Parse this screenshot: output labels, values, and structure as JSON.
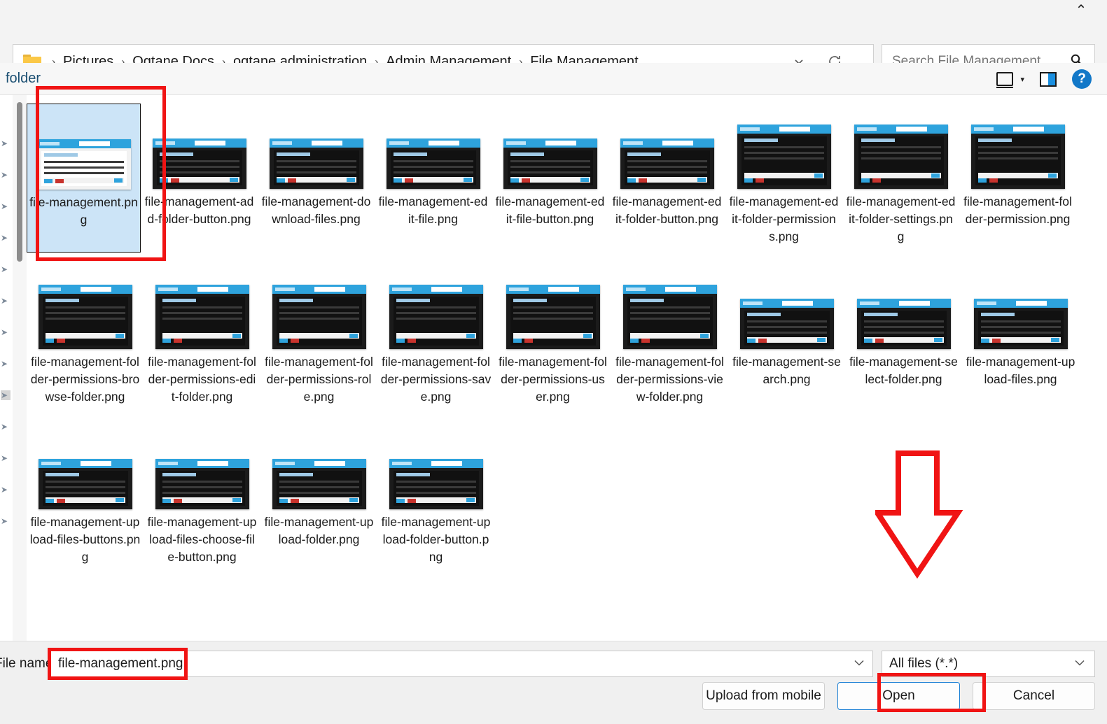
{
  "window": {
    "close_label": "⌃"
  },
  "address": {
    "folder_icon": "folder-icon",
    "breadcrumbs": [
      "Pictures",
      "Oqtane Docs",
      "oqtane administration",
      "Admin Management",
      "File Management"
    ],
    "separator": "›",
    "dropdown_icon": "chevron-down-icon",
    "refresh_icon": "refresh-icon"
  },
  "search": {
    "placeholder": "Search File Management",
    "icon": "search-icon"
  },
  "commandbar": {
    "folder_label": "folder",
    "view_icon": "view-layout-icon",
    "view_caret": "▾",
    "preview_pane_icon": "preview-pane-icon",
    "help_icon": "help-icon",
    "help_label": "?"
  },
  "files": [
    {
      "name": "file-management.png",
      "selected": true,
      "style": "light"
    },
    {
      "name": "file-management-add-folder-button.png",
      "selected": false,
      "style": "dark"
    },
    {
      "name": "file-management-download-files.png",
      "selected": false,
      "style": "dark"
    },
    {
      "name": "file-management-edit-file.png",
      "selected": false,
      "style": "dark"
    },
    {
      "name": "file-management-edit-file-button.png",
      "selected": false,
      "style": "dark"
    },
    {
      "name": "file-management-edit-folder-button.png",
      "selected": false,
      "style": "dark"
    },
    {
      "name": "file-management-edit-folder-permissions.png",
      "selected": false,
      "style": "tall"
    },
    {
      "name": "file-management-edit-folder-settings.png",
      "selected": false,
      "style": "tall"
    },
    {
      "name": "file-management-folder-permission.png",
      "selected": false,
      "style": "tall"
    },
    {
      "name": "file-management-folder-permissions-browse-folder.png",
      "selected": false,
      "style": "tall"
    },
    {
      "name": "file-management-folder-permissions-edit-folder.png",
      "selected": false,
      "style": "tall"
    },
    {
      "name": "file-management-folder-permissions-role.png",
      "selected": false,
      "style": "tall"
    },
    {
      "name": "file-management-folder-permissions-save.png",
      "selected": false,
      "style": "tall"
    },
    {
      "name": "file-management-folder-permissions-user.png",
      "selected": false,
      "style": "tall"
    },
    {
      "name": "file-management-folder-permissions-view-folder.png",
      "selected": false,
      "style": "tall"
    },
    {
      "name": "file-management-search.png",
      "selected": false,
      "style": "dark"
    },
    {
      "name": "file-management-select-folder.png",
      "selected": false,
      "style": "dark"
    },
    {
      "name": "file-management-upload-files.png",
      "selected": false,
      "style": "dark"
    },
    {
      "name": "file-management-upload-files-buttons.png",
      "selected": false,
      "style": "dark"
    },
    {
      "name": "file-management-upload-files-choose-file-button.png",
      "selected": false,
      "style": "dark"
    },
    {
      "name": "file-management-upload-folder.png",
      "selected": false,
      "style": "dark"
    },
    {
      "name": "file-management-upload-folder-button.png",
      "selected": false,
      "style": "dark"
    }
  ],
  "footer": {
    "filename_label": "File name:",
    "filename_value": "file-management.png",
    "filename_caret": "⌄",
    "filetype_value": "All files (*.*)",
    "filetype_caret": "⌄",
    "upload_button": "Upload from mobile",
    "open_button": "Open",
    "cancel_button": "Cancel"
  },
  "annotations": {
    "arrow_color": "#f01414",
    "box_color": "#f01414"
  }
}
